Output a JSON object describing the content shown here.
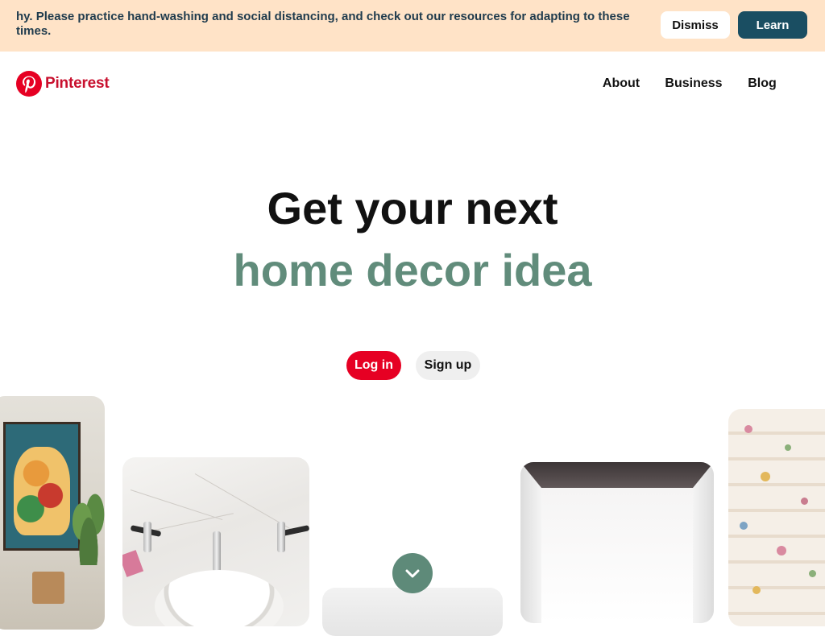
{
  "banner": {
    "text": "hy. Please practice hand-washing and social distancing, and check out our resources for adapting to these times.",
    "dismiss_label": "Dismiss",
    "learn_label": "Learn"
  },
  "header": {
    "logo_text": "Pinterest",
    "brand_color": "#e60023",
    "nav": [
      {
        "label": "About"
      },
      {
        "label": "Business"
      },
      {
        "label": "Blog"
      }
    ]
  },
  "hero": {
    "line1": "Get your next",
    "line2": "home decor idea",
    "accent_color": "#618c7b",
    "login_label": "Log in",
    "signup_label": "Sign up"
  },
  "icons": {
    "logo": "pinterest-logo-icon",
    "scroll": "chevron-down-icon"
  }
}
